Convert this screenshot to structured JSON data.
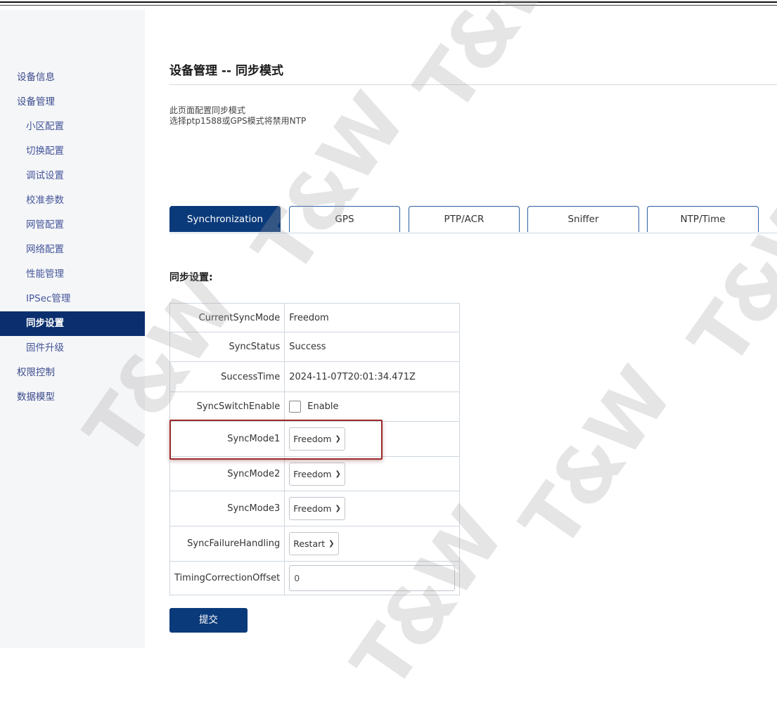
{
  "sidebar": {
    "items": [
      {
        "label": "设备信息",
        "level": 1
      },
      {
        "label": "设备管理",
        "level": 1
      },
      {
        "label": "小区配置",
        "level": 2
      },
      {
        "label": "切换配置",
        "level": 2
      },
      {
        "label": "调试设置",
        "level": 2
      },
      {
        "label": "校准参数",
        "level": 2
      },
      {
        "label": "网管配置",
        "level": 2
      },
      {
        "label": "网络配置",
        "level": 2
      },
      {
        "label": "性能管理",
        "level": 2
      },
      {
        "label": "IPSec管理",
        "level": 2
      },
      {
        "label": "同步设置",
        "level": 2,
        "active": true
      },
      {
        "label": "固件升级",
        "level": 2
      },
      {
        "label": "权限控制",
        "level": 1
      },
      {
        "label": "数据模型",
        "level": 1
      }
    ]
  },
  "page": {
    "title": "设备管理 -- 同步模式",
    "desc_line1": "此页面配置同步模式",
    "desc_line2": "选择ptp1588或GPS模式将禁用NTP"
  },
  "tabs": [
    {
      "label": "Synchronization",
      "active": true
    },
    {
      "label": "GPS"
    },
    {
      "label": "PTP/ACR"
    },
    {
      "label": "Sniffer"
    },
    {
      "label": "NTP/Time"
    }
  ],
  "section_label": "同步设置:",
  "form": {
    "current_sync_mode": {
      "label": "CurrentSyncMode",
      "value": "Freedom"
    },
    "sync_status": {
      "label": "SyncStatus",
      "value": "Success"
    },
    "success_time": {
      "label": "SuccessTime",
      "value": "2024-11-07T20:01:34.471Z"
    },
    "sync_switch_enable": {
      "label": "SyncSwitchEnable",
      "option": "Enable",
      "checked": false
    },
    "sync_mode1": {
      "label": "SyncMode1",
      "selected": "Freedom"
    },
    "sync_mode2": {
      "label": "SyncMode2",
      "selected": "Freedom"
    },
    "sync_mode3": {
      "label": "SyncMode3",
      "selected": "Freedom"
    },
    "sync_failure_handling": {
      "label": "SyncFailureHandling",
      "selected": "Restart"
    },
    "timing_correction_offset": {
      "label": "TimingCorrectionOffset",
      "value": "0"
    }
  },
  "submit_label": "提交",
  "watermark": "T&W",
  "colors": {
    "accent": "#0b3a7a",
    "sidebar_active": "#0b2f6e",
    "highlight_box": "#9b2a2a"
  }
}
